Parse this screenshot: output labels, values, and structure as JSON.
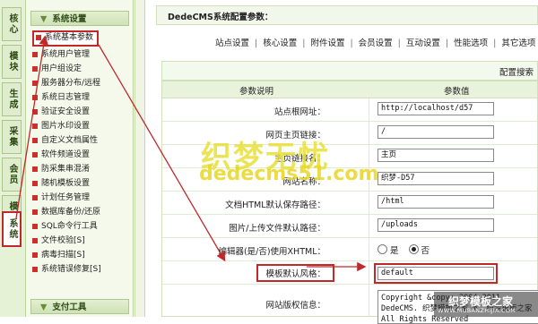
{
  "vtabs": [
    {
      "label": "核心",
      "active": false
    },
    {
      "label": "模块",
      "active": false
    },
    {
      "label": "生成",
      "active": false
    },
    {
      "label": "采集",
      "active": false
    },
    {
      "label": "会员",
      "active": false
    },
    {
      "label": "模板",
      "active": false
    },
    {
      "label": "系统",
      "active": true
    }
  ],
  "menu": {
    "section_title": "系统设置",
    "items": [
      {
        "label": "系统基本参数",
        "selected": true
      },
      {
        "label": "系统用户管理"
      },
      {
        "label": "用户组设定"
      },
      {
        "label": "服务器分布/远程"
      },
      {
        "label": "系统日志管理"
      },
      {
        "label": "验证安全设置"
      },
      {
        "label": "图片水印设置"
      },
      {
        "label": "自定义文档属性"
      },
      {
        "label": "软件频道设置"
      },
      {
        "label": "防采集串混淆"
      },
      {
        "label": "随机模板设置"
      },
      {
        "label": "计划任务管理"
      },
      {
        "label": "数据库备份/还原"
      },
      {
        "label": "SQL命令行工具"
      },
      {
        "label": "文件校验[S]"
      },
      {
        "label": "病毒扫描[S]"
      },
      {
        "label": "系统错误修复[S]"
      }
    ],
    "section2_title": "支付工具"
  },
  "main": {
    "title": "DedeCMS系统配置参数：",
    "tabs": [
      "站点设置",
      "核心设置",
      "附件设置",
      "会员设置",
      "互动设置",
      "性能选项",
      "其它选项"
    ],
    "config_label": "配置搜索",
    "header": {
      "col1": "参数说明",
      "col2": "参数值"
    },
    "rows": [
      {
        "label": "站点根网址：",
        "value": "http://localhost/d57"
      },
      {
        "label": "网页主页链接：",
        "value": "/"
      },
      {
        "label": "主页链接名：",
        "value": "主页"
      },
      {
        "label": "网站名称：",
        "value": "织梦-D57"
      },
      {
        "label": "文档HTML默认保存路径：",
        "value": "/html"
      },
      {
        "label": "图片/上传文件默认路径：",
        "value": "/uploads"
      },
      {
        "label": "编辑器(是/否)使用XHTML：",
        "radio_yes": "是",
        "radio_no": "否",
        "selected": "否"
      },
      {
        "label": "模板默认风格：",
        "value": "default"
      },
      {
        "label": "网站版权信息：",
        "value": "Copyright &copy; 2004-2011 DedeCMS. 织梦模板之家 m. 织梦模板之家 All Rights Reserved"
      }
    ]
  },
  "watermark": {
    "line1": "织梦无忧",
    "line2": "dedecms51.com",
    "badge_title": "织梦模板之家",
    "badge_url": "WWW.MUBANZHIJIA.COM"
  },
  "colors": {
    "highlight": "#c0282a",
    "menu_bg": "#f4f9ec",
    "header_bg": "#e9f3dc"
  }
}
